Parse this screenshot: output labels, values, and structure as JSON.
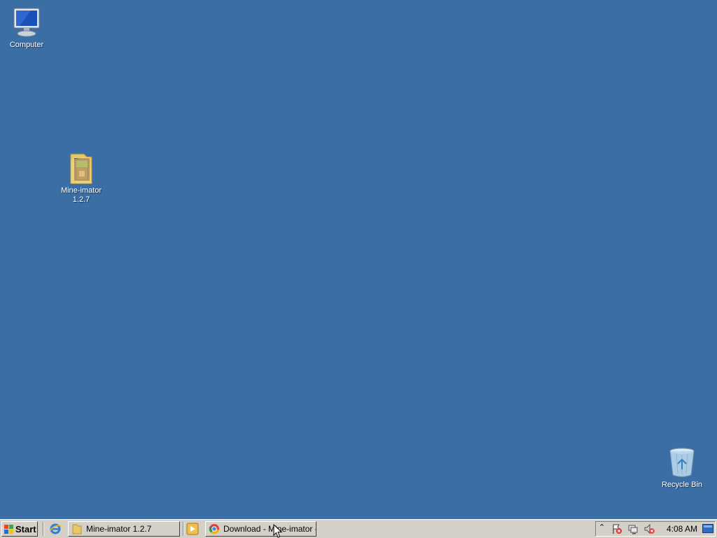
{
  "desktop": {
    "background": "#3a6ea5",
    "icons": [
      {
        "label": "Computer",
        "icon": "computer-icon"
      },
      {
        "label": "Mine-imator 1.2.7",
        "icon": "folder-icon"
      },
      {
        "label": "Recycle Bin",
        "icon": "recycle-bin-icon"
      }
    ]
  },
  "taskbar": {
    "start_label": "Start",
    "quick_launch": [
      {
        "icon": "internet-explorer-icon"
      },
      {
        "icon": "media-player-icon"
      }
    ],
    "tasks": [
      {
        "label": "Mine-imator 1.2.7",
        "icon": "folder-icon"
      },
      {
        "label": "Download - Mine-imator -...",
        "icon": "chrome-icon"
      }
    ],
    "tray": {
      "icons": [
        "show-hidden-icons-icon",
        "action-center-flag-icon",
        "network-icon",
        "volume-muted-icon",
        "show-desktop-icon"
      ],
      "clock": "4:08 AM"
    }
  }
}
